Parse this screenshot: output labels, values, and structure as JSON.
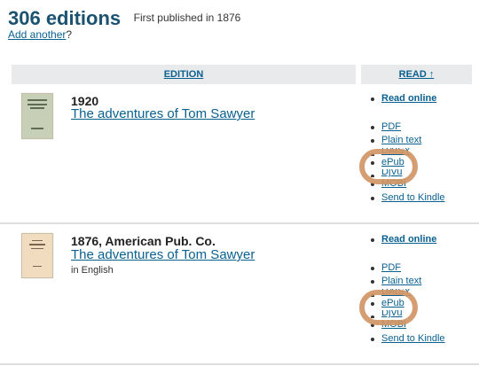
{
  "header": {
    "edition_count": "306 editions",
    "first_published": "First published in 1876",
    "add_link": "Add another",
    "add_suffix": "?"
  },
  "columns": {
    "edition": "EDITION",
    "read": "READ ↑"
  },
  "editions": [
    {
      "year_publisher": "1920",
      "title": "The adventures of Tom Sawyer",
      "language": "",
      "read_online": "Read online",
      "formats": [
        "PDF",
        "Plain text",
        "DAISY",
        "ePub",
        "DjVu",
        "MOBI",
        "Send to Kindle"
      ]
    },
    {
      "year_publisher": "1876, American Pub. Co.",
      "title": "The adventures of Tom Sawyer",
      "language": "in English",
      "read_online": "Read online",
      "formats": [
        "PDF",
        "Plain text",
        "DAISY",
        "ePub",
        "DjVu",
        "MOBI",
        "Send to Kindle"
      ]
    }
  ],
  "colors": {
    "link": "#0a6190",
    "title": "#1a5270",
    "header_bg": "#e9eaec",
    "highlight": "#d09463"
  }
}
